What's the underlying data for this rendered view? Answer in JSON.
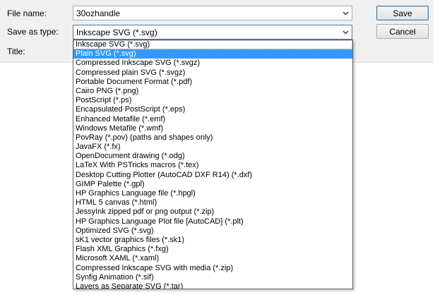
{
  "dialog": {
    "file_name_label": "File name:",
    "file_name_value": "30ozhandle",
    "save_as_type_label": "Save as type:",
    "save_as_type_value": "Inkscape SVG (*.svg)",
    "title_label": "Title:",
    "save_button": "Save",
    "cancel_button": "Cancel"
  },
  "dropdown": {
    "selected_index": 1,
    "options": [
      "Inkscape SVG (*.svg)",
      "Plain SVG (*.svg)",
      "Compressed Inkscape SVG (*.svgz)",
      "Compressed plain SVG (*.svgz)",
      "Portable Document Format (*.pdf)",
      "Cairo PNG (*.png)",
      "PostScript (*.ps)",
      "Encapsulated PostScript (*.eps)",
      "Enhanced Metafile (*.emf)",
      "Windows Metafile (*.wmf)",
      "PovRay (*.pov) (paths and shapes only)",
      "JavaFX (*.fx)",
      "OpenDocument drawing (*.odg)",
      "LaTeX With PSTricks macros (*.tex)",
      "Desktop Cutting Plotter (AutoCAD DXF R14) (*.dxf)",
      "GIMP Palette (*.gpl)",
      "HP Graphics Language file (*.hpgl)",
      "HTML 5 canvas (*.html)",
      "JessyInk zipped pdf or png output (*.zip)",
      "HP Graphics Language Plot file [AutoCAD] (*.plt)",
      "Optimized SVG (*.svg)",
      "sK1 vector graphics files (*.sk1)",
      "Flash XML Graphics (*.fxg)",
      "Microsoft XAML (*.xaml)",
      "Compressed Inkscape SVG with media (*.zip)",
      "Synfig Animation (*.sif)",
      "Layers as Separate SVG (*.tar)"
    ]
  },
  "icons": {
    "chevron": "chevron-down-icon"
  }
}
